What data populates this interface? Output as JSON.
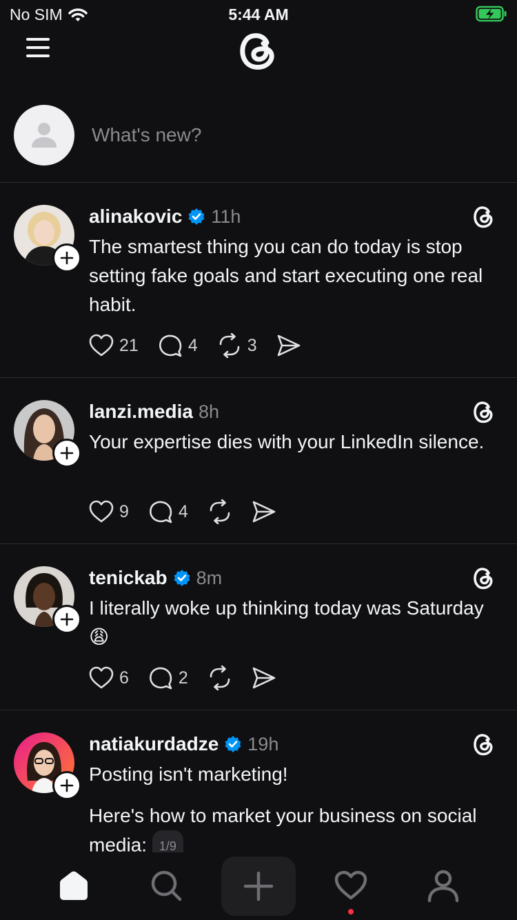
{
  "status_bar": {
    "carrier": "No SIM",
    "time": "5:44 AM"
  },
  "composer": {
    "placeholder": "What's new?"
  },
  "posts": [
    {
      "username": "alinakovic",
      "verified": true,
      "time": "11h",
      "text": "The smartest thing you can do today is stop setting fake goals and start executing one real habit.",
      "likes": "21",
      "replies": "4",
      "reposts": "3"
    },
    {
      "username": "lanzi.media",
      "verified": false,
      "time": "8h",
      "text": "Your expertise dies with your LinkedIn silence.",
      "likes": "9",
      "replies": "4",
      "reposts": ""
    },
    {
      "username": "tenickab",
      "verified": true,
      "time": "8m",
      "text": "I literally woke up thinking today was Saturday 😩",
      "likes": "6",
      "replies": "2",
      "reposts": ""
    },
    {
      "username": "natiakurdadze",
      "verified": true,
      "time": "19h",
      "text": "Posting isn't marketing!",
      "text2": "Here's how to market your business on social media:",
      "carousel": "1/9"
    }
  ],
  "tab_bar": {
    "items": [
      "home-icon",
      "search-icon",
      "new-post-icon",
      "activity-icon",
      "profile-icon"
    ],
    "active": "home-icon"
  },
  "colors": {
    "background": "#101012",
    "verified": "#0095f6",
    "notification": "#ff3040"
  }
}
